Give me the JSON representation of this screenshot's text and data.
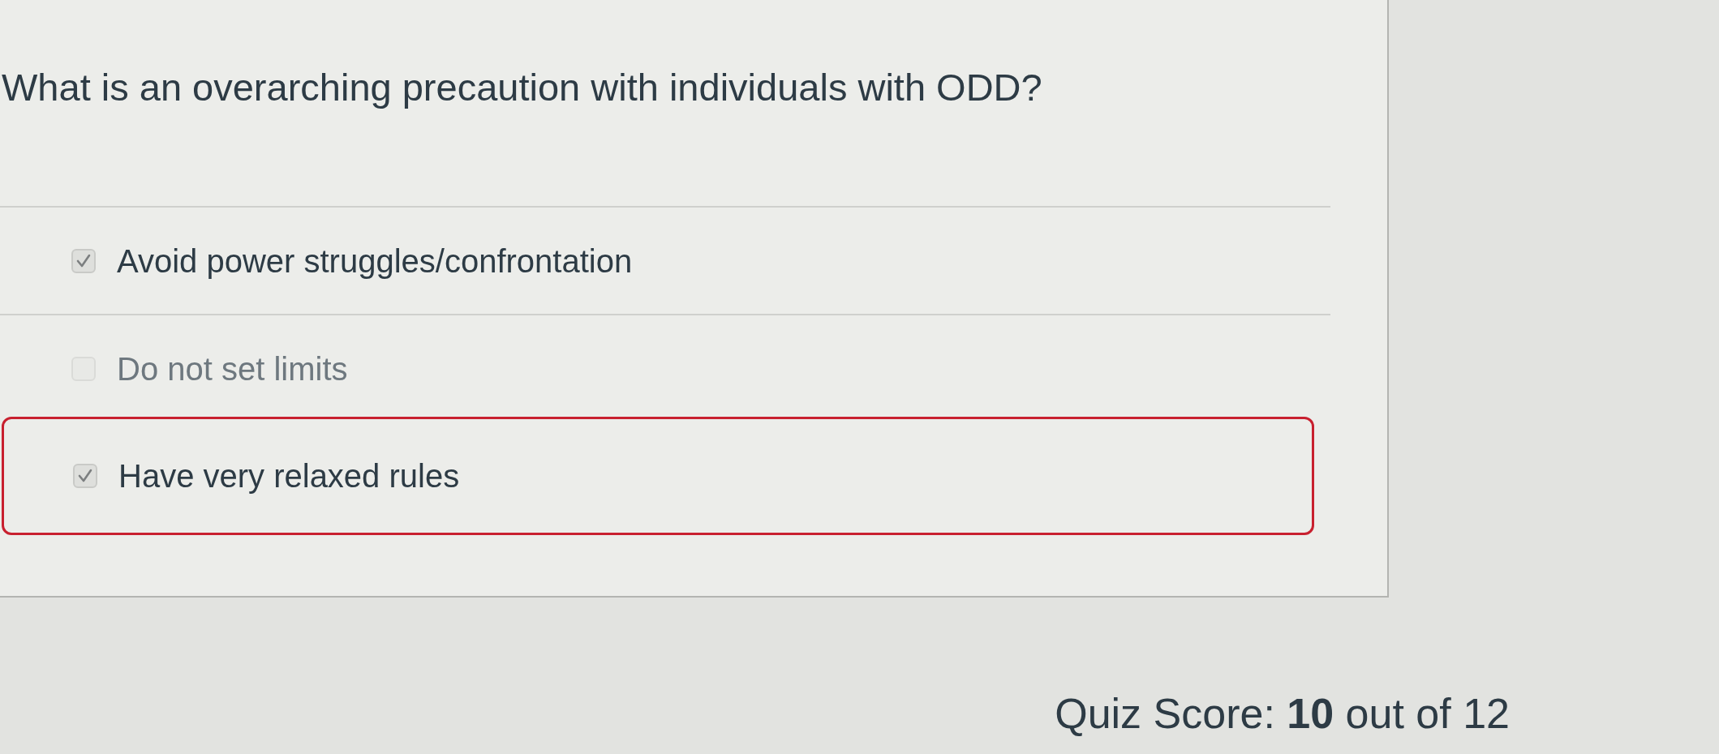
{
  "question": {
    "text": "What is an overarching precaution with individuals with ODD?"
  },
  "answers": [
    {
      "label": "Avoid power struggles/confrontation",
      "checked": true,
      "flagged": false
    },
    {
      "label": "Do not set limits",
      "checked": false,
      "flagged": false
    },
    {
      "label": "Have very relaxed rules",
      "checked": true,
      "flagged": true
    }
  ],
  "quiz_score": {
    "text": "Quiz Score: **10** out of 12"
  }
}
